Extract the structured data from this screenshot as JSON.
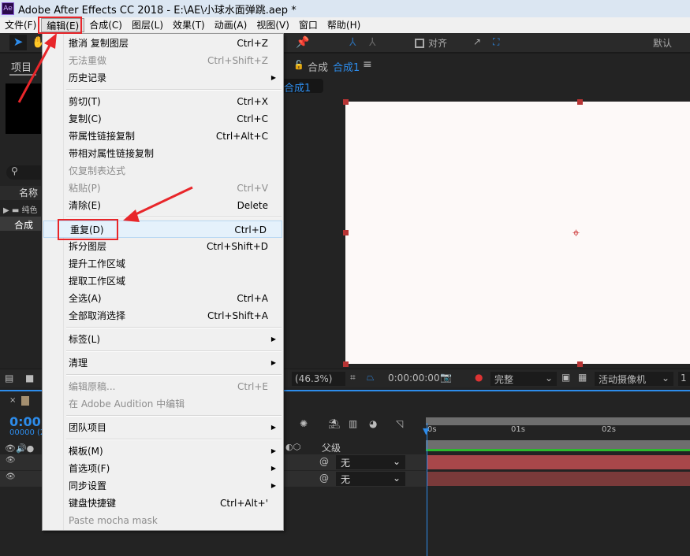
{
  "window": {
    "title": "Adobe After Effects CC 2018 - E:\\AE\\小球水面弹跳.aep *",
    "logo": "Ae"
  },
  "menubar": [
    "文件(F)",
    "编辑(E)",
    "合成(C)",
    "图层(L)",
    "效果(T)",
    "动画(A)",
    "视图(V)",
    "窗口",
    "帮助(H)"
  ],
  "toolbar": {
    "snap_label": "对齐",
    "workspace": "默认"
  },
  "project": {
    "tab": "项目",
    "column_name": "名称",
    "items": [
      "纯色",
      "合成"
    ]
  },
  "comp": {
    "lock_label": "合成",
    "active_comp": "合成1",
    "comp_tab": "合成1"
  },
  "viewer_bar": {
    "zoom": "(46.3%)",
    "timecode": "0:00:00:00",
    "quality": "完整",
    "camera": "活动摄像机",
    "views": "1"
  },
  "timeline": {
    "timecode": "0:00:",
    "frames": "00000 (2",
    "parent_header": "父级",
    "ruler": [
      "0s",
      "01s",
      "02s"
    ],
    "layers": [
      {
        "parent": "无"
      },
      {
        "parent": "无"
      }
    ]
  },
  "edit_menu": [
    {
      "label": "撤消 复制图层",
      "shortcut": "Ctrl+Z"
    },
    {
      "label": "无法重做",
      "shortcut": "Ctrl+Shift+Z",
      "disabled": true
    },
    {
      "label": "历史记录",
      "submenu": true
    },
    {
      "sep": true
    },
    {
      "label": "剪切(T)",
      "shortcut": "Ctrl+X"
    },
    {
      "label": "复制(C)",
      "shortcut": "Ctrl+C"
    },
    {
      "label": "带属性链接复制",
      "shortcut": "Ctrl+Alt+C"
    },
    {
      "label": "带相对属性链接复制"
    },
    {
      "label": "仅复制表达式",
      "disabled": true
    },
    {
      "label": "粘贴(P)",
      "shortcut": "Ctrl+V",
      "disabled": true
    },
    {
      "label": "清除(E)",
      "shortcut": "Delete"
    },
    {
      "sep": true
    },
    {
      "label": "重复(D)",
      "shortcut": "Ctrl+D",
      "highlighted": true
    },
    {
      "label": "拆分图层",
      "shortcut": "Ctrl+Shift+D"
    },
    {
      "label": "提升工作区域"
    },
    {
      "label": "提取工作区域"
    },
    {
      "label": "全选(A)",
      "shortcut": "Ctrl+A"
    },
    {
      "label": "全部取消选择",
      "shortcut": "Ctrl+Shift+A"
    },
    {
      "sep": true
    },
    {
      "label": "标签(L)",
      "submenu": true
    },
    {
      "sep": true
    },
    {
      "label": "清理",
      "submenu": true
    },
    {
      "sep": true
    },
    {
      "label": "编辑原稿...",
      "shortcut": "Ctrl+E",
      "disabled": true
    },
    {
      "label": "在 Adobe Audition 中编辑",
      "disabled": true
    },
    {
      "sep": true
    },
    {
      "label": "团队项目",
      "submenu": true
    },
    {
      "sep": true
    },
    {
      "label": "模板(M)",
      "submenu": true
    },
    {
      "label": "首选项(F)",
      "submenu": true
    },
    {
      "label": "同步设置",
      "submenu": true
    },
    {
      "label": "键盘快捷键",
      "shortcut": "Ctrl+Alt+'"
    },
    {
      "label": "Paste mocha mask",
      "disabled": true
    }
  ],
  "colors": {
    "accent": "#2d8ceb",
    "annotation": "#e8262a",
    "layer_bar": "#a8474a"
  }
}
